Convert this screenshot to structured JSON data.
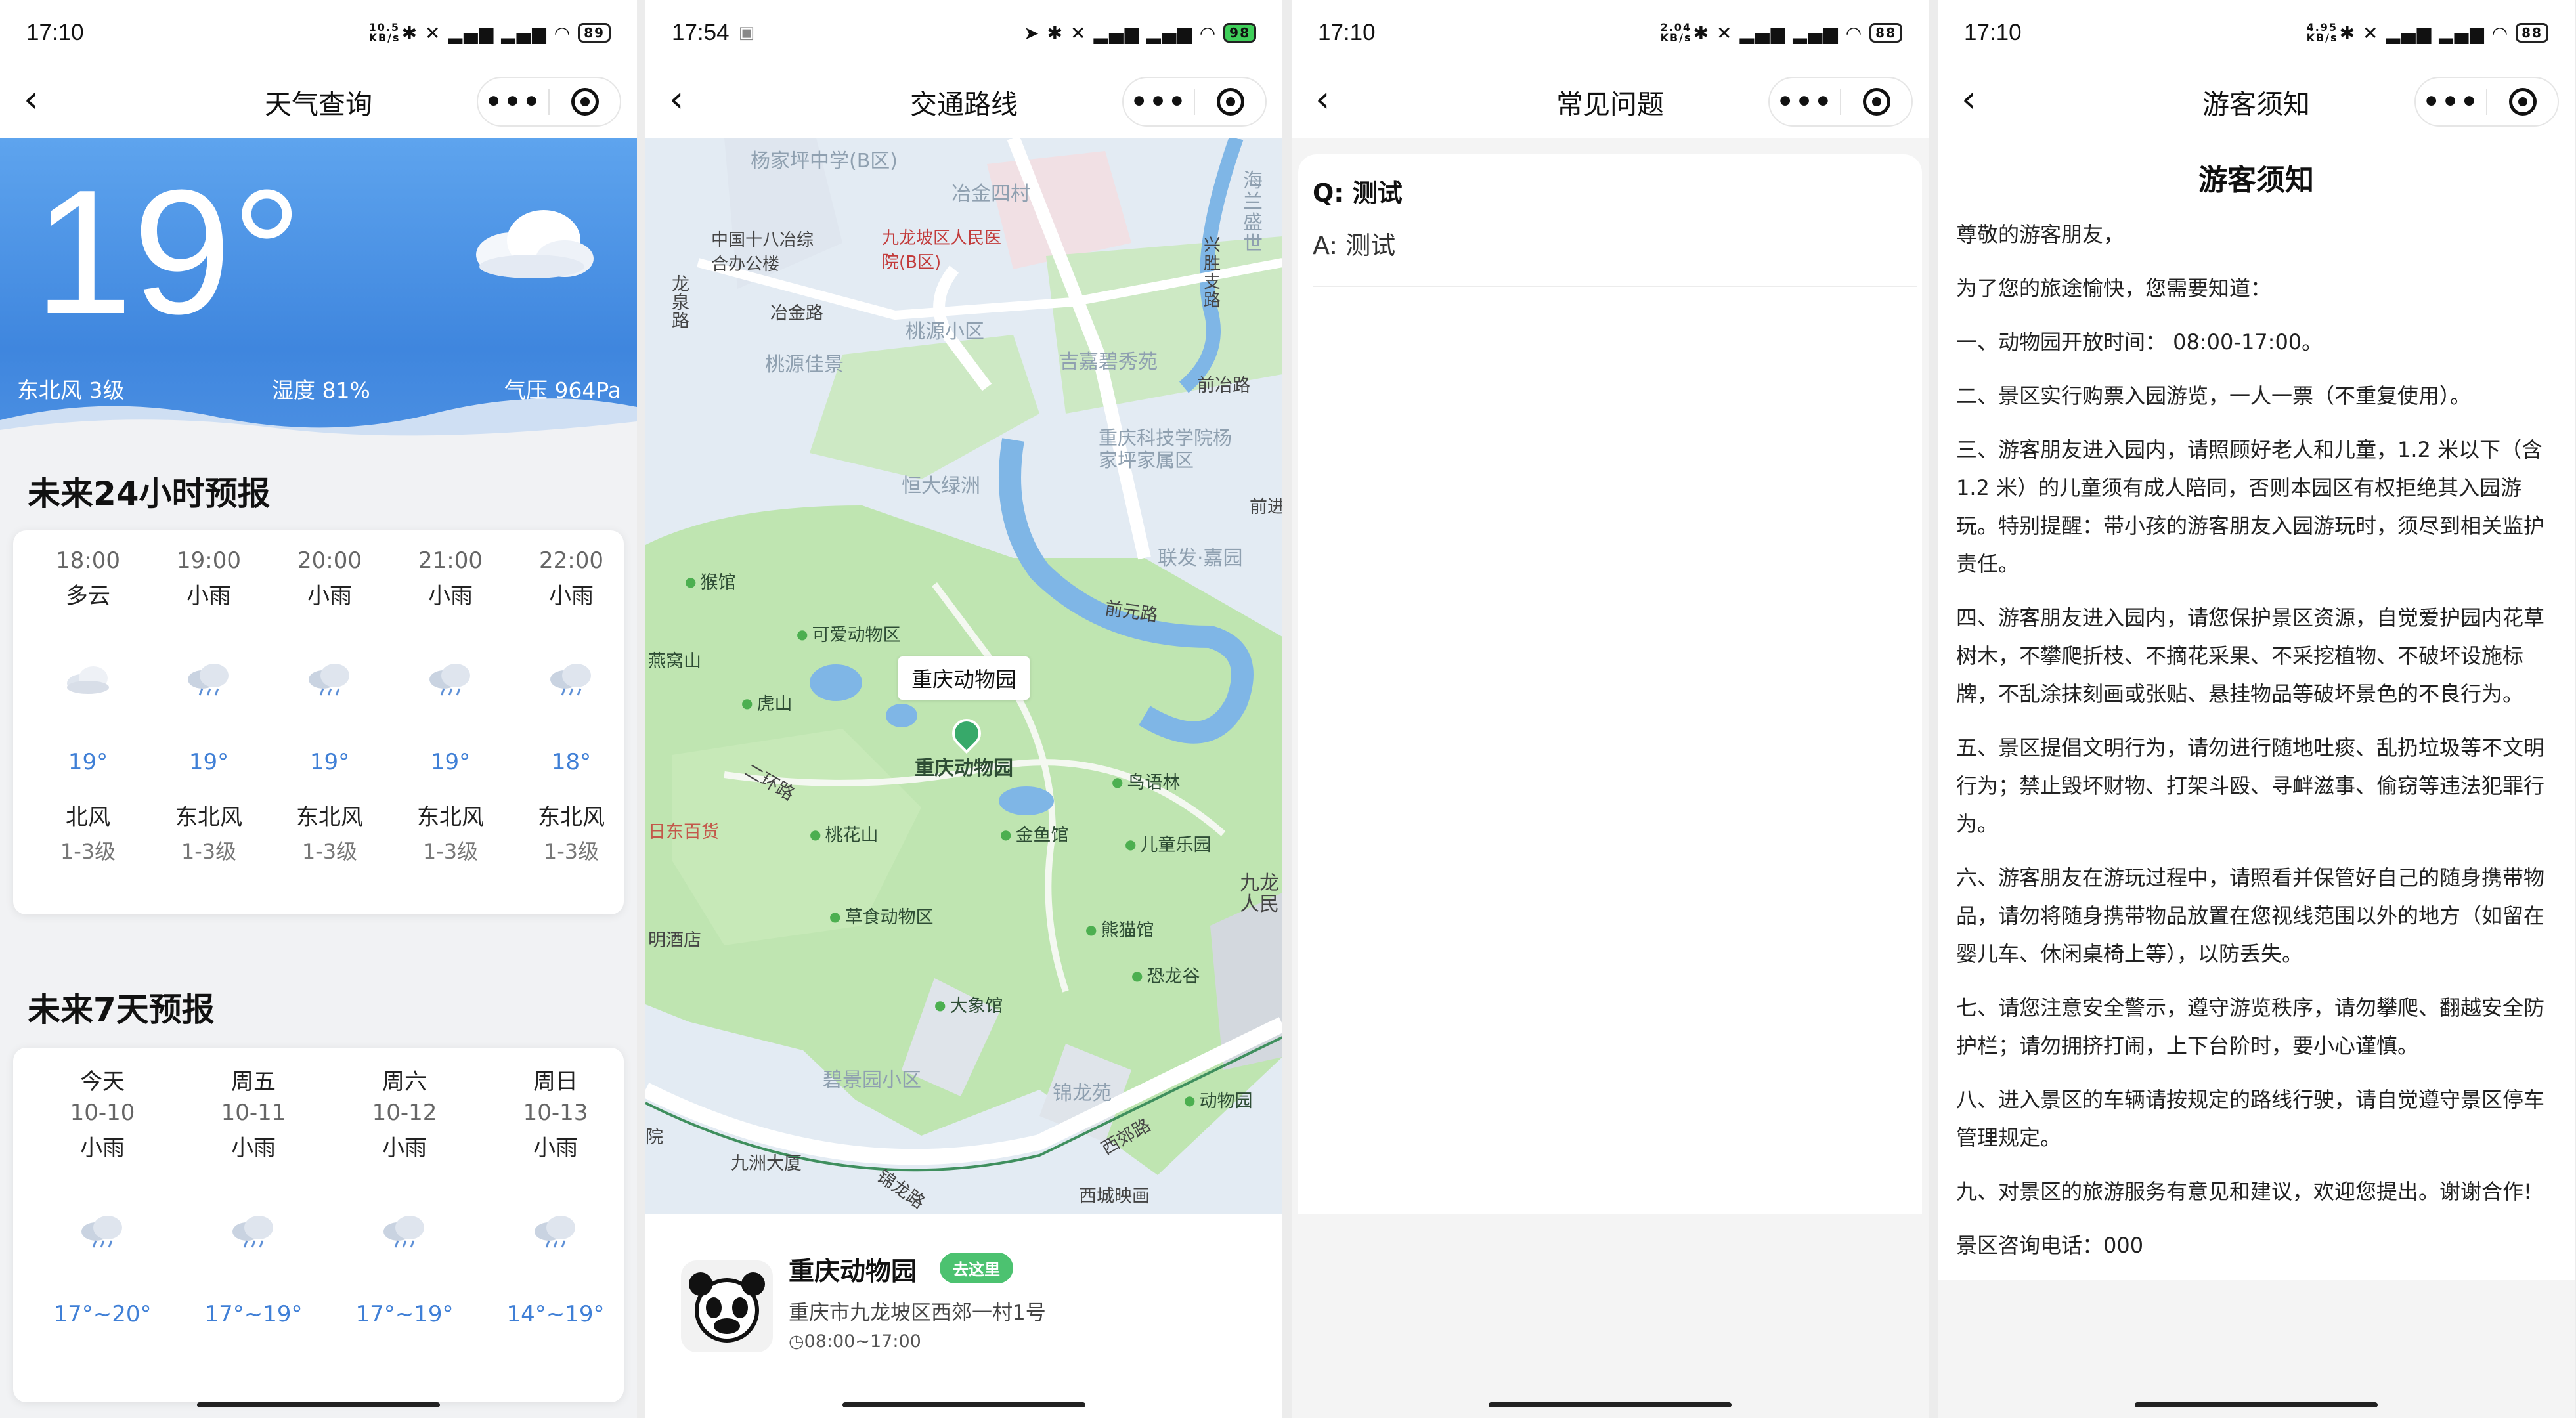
{
  "screens": [
    {
      "status": {
        "time": "17:10",
        "speed": "10.5 KB/s",
        "battery": "89"
      },
      "nav_title": "天气查询",
      "current": {
        "temperature": "19°",
        "wind": "东北风 3级",
        "humidity": "湿度 81%",
        "pressure": "气压 964Pa"
      },
      "hourly_title": "未来24小时预报",
      "hourly": [
        {
          "time": "18:00",
          "cond": "多云",
          "icon": "cloud-icon",
          "temp": "19°",
          "wind_dir": "北风",
          "wind_level": "1-3级"
        },
        {
          "time": "19:00",
          "cond": "小雨",
          "icon": "rain-cloud-icon",
          "temp": "19°",
          "wind_dir": "东北风",
          "wind_level": "1-3级"
        },
        {
          "time": "20:00",
          "cond": "小雨",
          "icon": "rain-cloud-icon",
          "temp": "19°",
          "wind_dir": "东北风",
          "wind_level": "1-3级"
        },
        {
          "time": "21:00",
          "cond": "小雨",
          "icon": "rain-cloud-icon",
          "temp": "19°",
          "wind_dir": "东北风",
          "wind_level": "1-3级"
        },
        {
          "time": "22:00",
          "cond": "小雨",
          "icon": "rain-cloud-icon",
          "temp": "18°",
          "wind_dir": "东北风",
          "wind_level": "1-3级"
        }
      ],
      "daily_title": "未来7天预报",
      "daily": [
        {
          "day": "今天",
          "date": "10-10",
          "cond": "小雨",
          "range": "17°~20°"
        },
        {
          "day": "周五",
          "date": "10-11",
          "cond": "小雨",
          "range": "17°~19°"
        },
        {
          "day": "周六",
          "date": "10-12",
          "cond": "小雨",
          "range": "17°~19°"
        },
        {
          "day": "周日",
          "date": "10-13",
          "cond": "小雨",
          "range": "14°~19°"
        }
      ]
    },
    {
      "status": {
        "time": "17:54",
        "battery": "98"
      },
      "nav_title": "交通路线",
      "map_labels": {
        "l1": "杨家坪中学(B区)",
        "l2": "冶金四村",
        "l3": "中国十八冶综合办公楼",
        "l4": "九龙坡区人民医院(B区)",
        "l5": "冶金路",
        "l6": "龙泉路",
        "l7": "桃源小区",
        "l8": "桃源佳景",
        "l9": "吉嘉碧秀苑",
        "l10": "前冶路",
        "l11": "兴胜支路",
        "l12": "恒大绿洲",
        "l13": "重庆科技学院杨家坪家属区",
        "l14": "前进",
        "l15": "联发·嘉园",
        "l16": "前元路",
        "l17": "猴馆",
        "l18": "可爱动物区",
        "l19": "燕窝山",
        "l20": "虎山",
        "l21": "二环路",
        "l22": "重庆动物园",
        "l23": "鸟语林",
        "l24": "日东百货",
        "l25": "桃花山",
        "l26": "金鱼馆",
        "l27": "儿童乐园",
        "l28": "九龙人民",
        "l29": "明酒店",
        "l30": "草食动物区",
        "l31": "熊猫馆",
        "l32": "恐龙谷",
        "l33": "大象馆",
        "l34": "碧景园小区",
        "l35": "锦龙苑",
        "l36": "西郊路",
        "l37": "动物园",
        "l38": "九洲大厦",
        "l39": "锦龙路",
        "l40": "西城映画",
        "l41": "海兰盛世",
        "l42": "院"
      },
      "bubble": "重庆动物园",
      "place": {
        "name": "重庆动物园",
        "button": "去这里",
        "address": "重庆市九龙坡区西郊一村1号",
        "hours": "08:00~17:00"
      }
    },
    {
      "status": {
        "time": "17:10",
        "speed": "2.04 KB/s",
        "battery": "88"
      },
      "nav_title": "常见问题",
      "question": "Q:  测试",
      "answer": "A:  测试"
    },
    {
      "status": {
        "time": "17:10",
        "speed": "4.95 KB/s",
        "battery": "88"
      },
      "nav_title": "游客须知",
      "heading": "游客须知",
      "paragraphs": [
        "尊敬的游客朋友，",
        "为了您的旅途愉快，您需要知道：",
        "一、动物园开放时间：  08:00-17:00。",
        "二、景区实行购票入园游览，一人一票（不重复使用）。",
        "三、游客朋友进入园内，请照顾好老人和儿童，1.2 米以下（含 1.2 米）的儿童须有成人陪同，否则本园区有权拒绝其入园游玩。特别提醒：带小孩的游客朋友入园游玩时，须尽到相关监护责任。",
        "四、游客朋友进入园内，请您保护景区资源，自觉爱护园内花草树木，不攀爬折枝、不摘花采果、不采挖植物、不破坏设施标牌，不乱涂抹刻画或张贴、悬挂物品等破坏景色的不良行为。",
        "五、景区提倡文明行为，请勿进行随地吐痰、乱扔垃圾等不文明行为；禁止毁坏财物、打架斗殴、寻衅滋事、偷窃等违法犯罪行为。",
        "六、游客朋友在游玩过程中，请照看并保管好自己的随身携带物品，请勿将随身携带物品放置在您视线范围以外的地方（如留在婴儿车、休闲桌椅上等），以防丢失。",
        "七、请您注意安全警示，遵守游览秩序，请勿攀爬、翻越安全防护栏；请勿拥挤打闹，上下台阶时，要小心谨慎。",
        "八、进入景区的车辆请按规定的路线行驶，请自觉遵守景区停车管理规定。",
        "九、对景区的旅游服务有意见和建议，欢迎您提出。谢谢合作!",
        "景区咨询电话：000"
      ]
    }
  ]
}
